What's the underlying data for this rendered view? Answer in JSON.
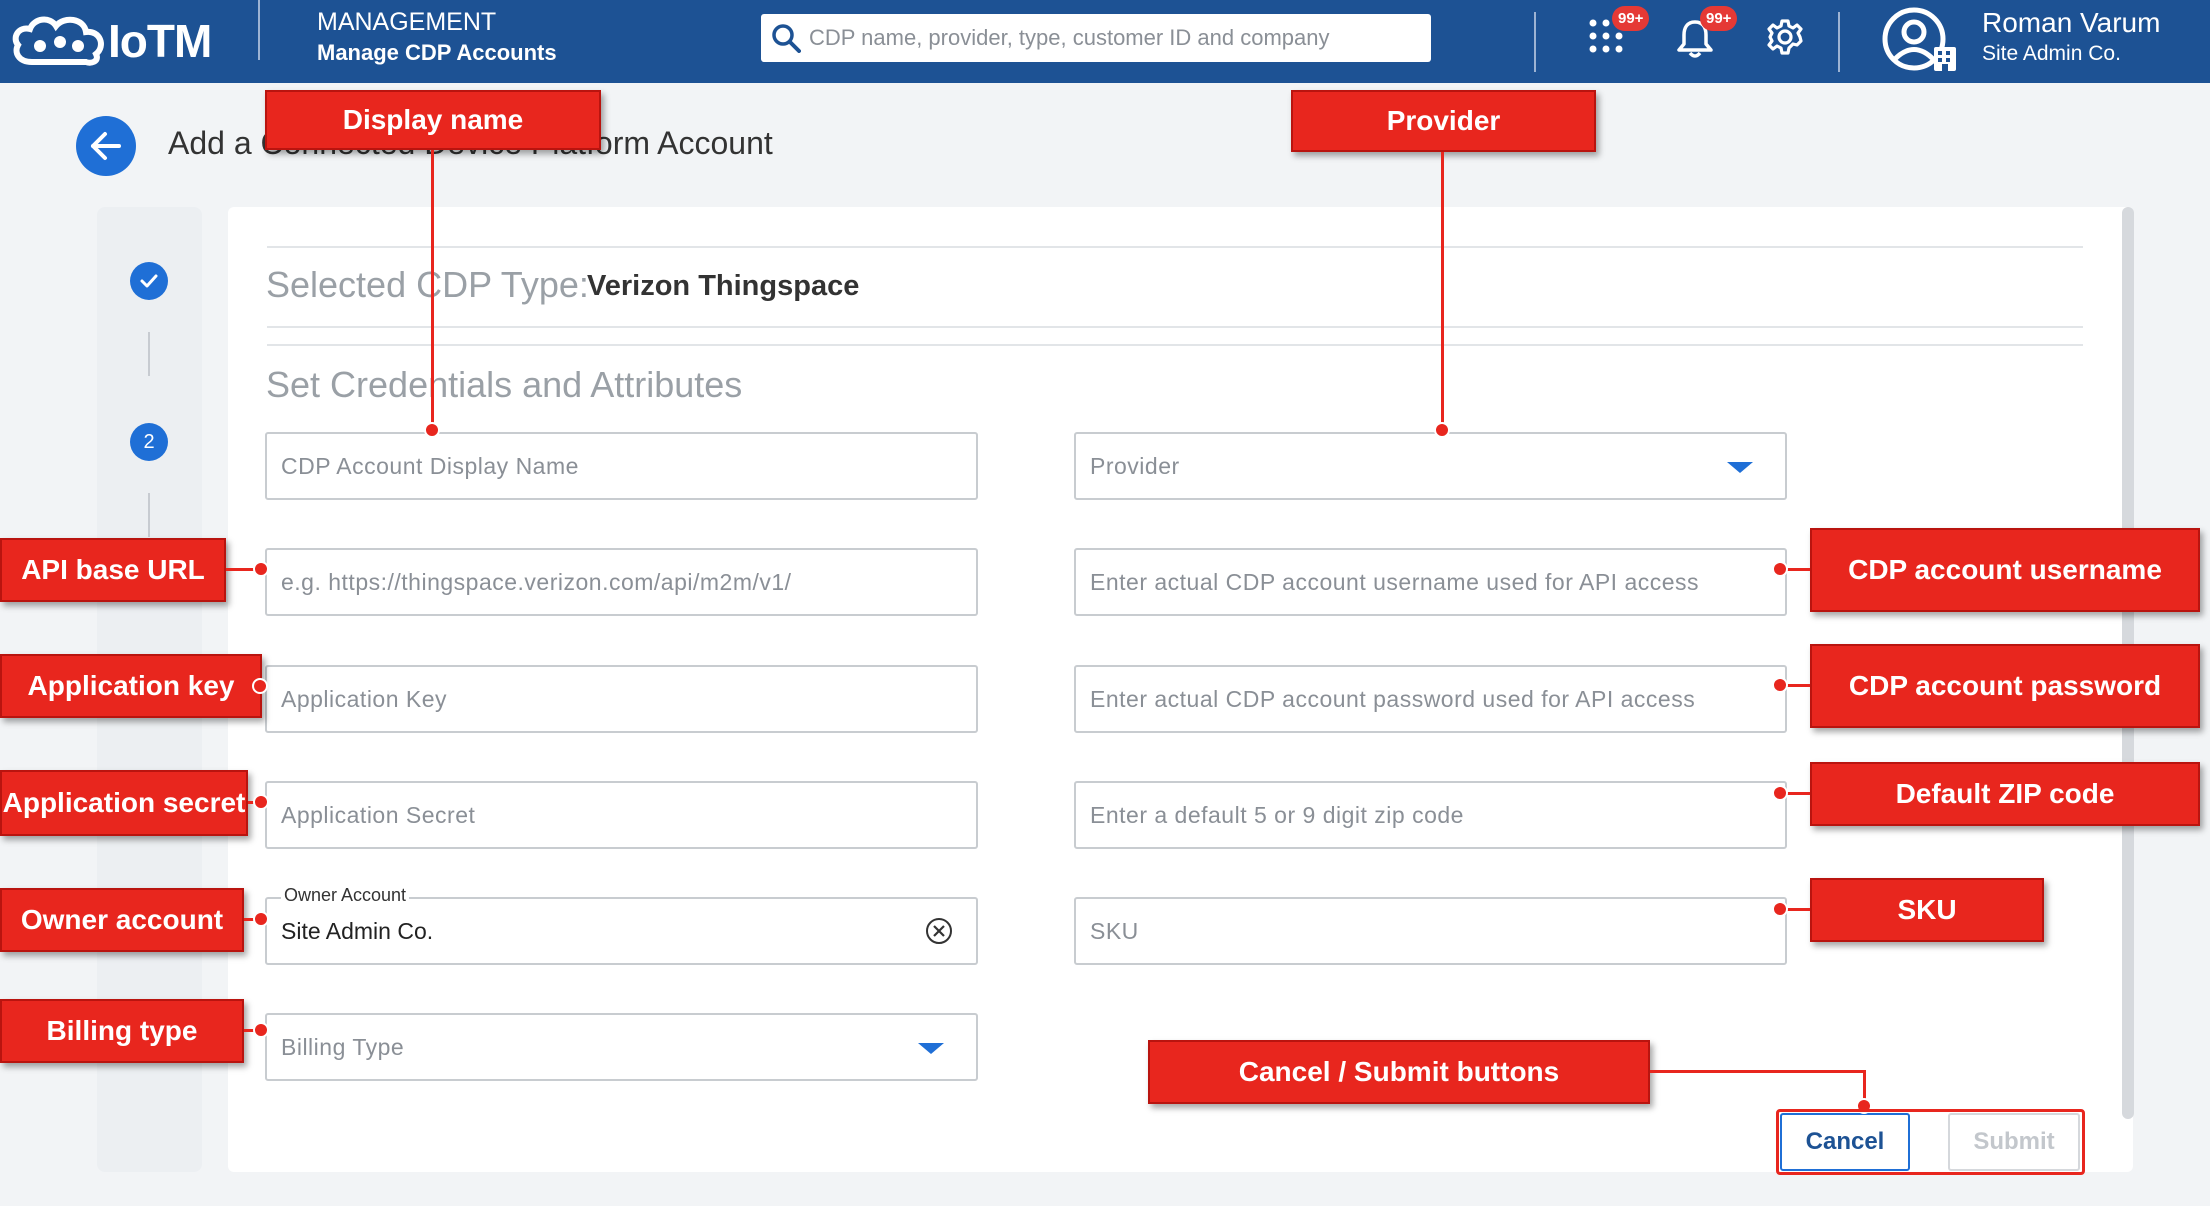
{
  "header": {
    "logo_text": "IoTM",
    "section_title": "MANAGEMENT",
    "section_subtitle": "Manage CDP Accounts",
    "search_placeholder": "CDP name, provider, type, customer ID and company",
    "apps_badge": "99+",
    "notifications_badge": "99+",
    "user_name": "Roman Varum",
    "user_org": "Site Admin Co."
  },
  "page": {
    "title": "Add a Connected Device Platform Account"
  },
  "stepper": {
    "steps": [
      "",
      "2"
    ]
  },
  "form": {
    "selected_type_label": "Selected CDP Type:",
    "selected_type_value": "Verizon Thingspace",
    "section_title": "Set Credentials and Attributes",
    "display_name_placeholder": "CDP Account Display Name",
    "api_base_url_placeholder": "e.g. https://thingspace.verizon.com/api/m2m/v1/",
    "application_key_placeholder": "Application Key",
    "application_secret_placeholder": "Application Secret",
    "owner_account_label": "Owner Account",
    "owner_account_value": "Site Admin Co.",
    "billing_type_placeholder": "Billing Type",
    "provider_placeholder": "Provider",
    "username_placeholder": "Enter actual CDP account username used for API access",
    "password_placeholder": "Enter actual CDP account password used for API access",
    "zip_placeholder": "Enter a default 5 or 9 digit zip code",
    "sku_placeholder": "SKU",
    "cancel_label": "Cancel",
    "submit_label": "Submit"
  },
  "annotations": {
    "display_name": "Display name",
    "provider": "Provider",
    "api_base_url": "API base URL",
    "application_key": "Application key",
    "application_secret": "Application secret",
    "owner_account": "Owner account",
    "billing_type": "Billing type",
    "cdp_username": "CDP account username",
    "cdp_password": "CDP account password",
    "default_zip": "Default ZIP code",
    "sku": "SKU",
    "cancel_submit": "Cancel / Submit buttons"
  },
  "colors": {
    "header_bg": "#1d5294",
    "accent": "#1f6fd6",
    "callout": "#e8261e"
  }
}
